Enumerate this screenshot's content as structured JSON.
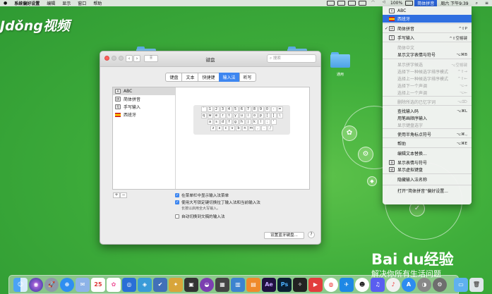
{
  "menubar": {
    "items": [
      "系统偏好设置",
      "编辑",
      "显示",
      "窗口",
      "帮助"
    ],
    "battery": "100%",
    "active_input": "简体拼音",
    "clock": "周六 下午9:39"
  },
  "watermark_top": "Jdǒng视频",
  "desktop": {
    "folder_label": "通用"
  },
  "keyboard_window": {
    "title": "键盘",
    "search_placeholder": "搜索",
    "tabs": [
      "键盘",
      "文本",
      "快捷键",
      "输入法",
      "听写"
    ],
    "active_tab": "输入法",
    "sources": [
      {
        "label": "ABC",
        "icon": "A"
      },
      {
        "label": "简体拼音",
        "icon": "拼"
      },
      {
        "label": "手写输入",
        "icon": "写"
      },
      {
        "label": "西班牙",
        "icon": "flag-spain"
      }
    ],
    "keyboard_rows": [
      [
        "`",
        "1",
        "2",
        "3",
        "4",
        "5",
        "6",
        "7",
        "8",
        "9",
        "0",
        "-",
        "="
      ],
      [
        "q",
        "w",
        "e",
        "r",
        "t",
        "y",
        "u",
        "i",
        "o",
        "p",
        "[",
        "]",
        "\\"
      ],
      [
        "a",
        "s",
        "d",
        "f",
        "g",
        "h",
        "j",
        "k",
        "l",
        ";",
        "'"
      ],
      [
        "z",
        "x",
        "c",
        "v",
        "b",
        "n",
        "m",
        ",",
        ".",
        "/"
      ]
    ],
    "add_label": "+",
    "remove_label": "−",
    "options": {
      "show_in_menu": "在菜单栏中显示输入法菜单",
      "caps_lock_switch": "使用大写锁定键切换拉丁输入法和当前输入法",
      "caps_lock_sub": "长按以启用全大写输入。",
      "auto_switch": "自动切换到文稿的输入法"
    },
    "bluetooth_button": "设置蓝牙键盘...",
    "help_button": "?"
  },
  "ime_menu": {
    "items": [
      {
        "label": "ABC",
        "shortcut": "",
        "icon": "A",
        "checked": false
      },
      {
        "label": "西班牙",
        "shortcut": "",
        "icon": "flag",
        "checked": false,
        "highlight": true
      },
      {
        "label": "简体拼音",
        "shortcut": "^⇧P",
        "icon": "拼",
        "checked": true
      },
      {
        "label": "手写输入",
        "shortcut": "^⇧空格键",
        "icon": "写",
        "checked": false
      },
      {
        "label": "简体中文",
        "shortcut": "",
        "disabled": true
      },
      {
        "label": "显示文字表情与符号",
        "shortcut": "⌥⌘B"
      },
      {
        "label": "显示拼字候选",
        "shortcut": "⌥空格键",
        "disabled": true
      },
      {
        "label": "选择下一种候选字排序模式",
        "shortcut": "^⇧→",
        "disabled": true
      },
      {
        "label": "选择上一种候选字排序模式",
        "shortcut": "^⇧←",
        "disabled": true
      },
      {
        "label": "选择下一个声调",
        "shortcut": "⌥→",
        "disabled": true
      },
      {
        "label": "选择上一个声调",
        "shortcut": "⌥←",
        "disabled": true
      },
      {
        "label": "删除所选的已忆字词",
        "shortcut": "⌥⌦",
        "disabled": true
      },
      {
        "label": "查找输入码",
        "shortcut": "⌥⌘L"
      },
      {
        "label": "用笔画顺序输入",
        "shortcut": ""
      },
      {
        "label": "显示键盘选字",
        "shortcut": "",
        "disabled": true
      },
      {
        "label": "使用半角标点符号",
        "shortcut": "⌥⌘.,"
      },
      {
        "label": "帮助",
        "shortcut": "⌥⌘E"
      },
      {
        "label": "编辑文本替换...",
        "shortcut": ""
      },
      {
        "label": "显示表情与符号",
        "shortcut": "",
        "icon": "表"
      },
      {
        "label": "显示虚拟键盘",
        "shortcut": "",
        "icon": "键"
      },
      {
        "label": "隐藏输入法名称",
        "shortcut": ""
      },
      {
        "label": "打开“简体拼音”偏好设置...",
        "shortcut": ""
      }
    ]
  },
  "baidu": {
    "logo": "Bai du经验",
    "slogan": "解决你所有生活问题"
  },
  "colors": {
    "desktop_green": "#3fae3b",
    "accent_blue": "#3d86f0",
    "menu_highlight": "#2f6fe0",
    "close_red": "#fc605b"
  }
}
